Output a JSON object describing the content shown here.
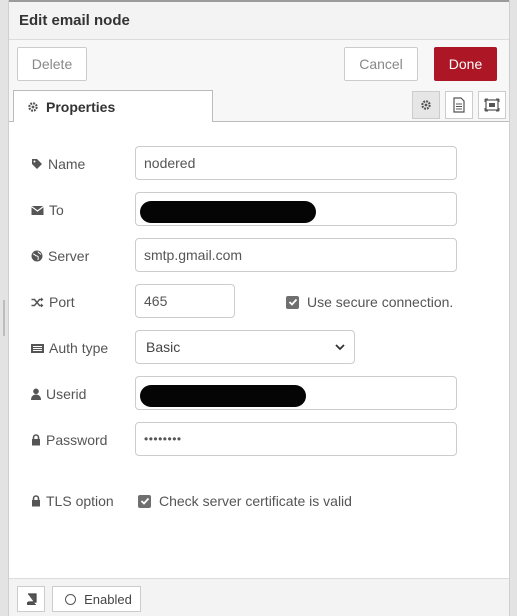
{
  "tray": {
    "title": "Edit email node"
  },
  "toolbar": {
    "delete_label": "Delete",
    "cancel_label": "Cancel",
    "done_label": "Done"
  },
  "tabs": {
    "properties_label": "Properties",
    "icons": [
      "gear-icon",
      "document-icon",
      "appearance-icon"
    ]
  },
  "form": {
    "name": {
      "label": "Name",
      "value": "nodered"
    },
    "to": {
      "label": "To",
      "value": ""
    },
    "server": {
      "label": "Server",
      "value": "smtp.gmail.com"
    },
    "port": {
      "label": "Port",
      "value": "465",
      "secure_label": "Use secure connection.",
      "secure_checked": true
    },
    "auth_type": {
      "label": "Auth type",
      "value": "Basic"
    },
    "userid": {
      "label": "Userid",
      "value": ""
    },
    "password": {
      "label": "Password",
      "value": "••••••••"
    },
    "tls": {
      "label": "TLS option",
      "check_label": "Check server certificate is valid",
      "checked": true
    }
  },
  "footer": {
    "enabled_label": "Enabled"
  },
  "colors": {
    "done_button": "#ad1625",
    "tray_header": "#f3f3f3",
    "border": "#cccccc"
  }
}
